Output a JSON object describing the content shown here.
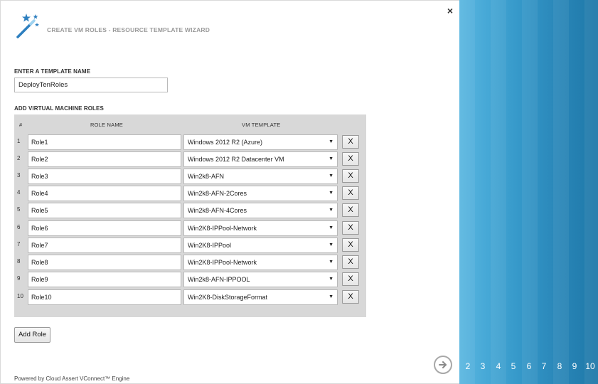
{
  "header": {
    "title": "CREATE VM ROLES - RESOURCE TEMPLATE WIZARD",
    "close_label": "×"
  },
  "template": {
    "label": "ENTER A TEMPLATE NAME",
    "value": "DeployTenRoles"
  },
  "roles": {
    "label": "ADD VIRTUAL MACHINE ROLES",
    "columns": {
      "hash": "#",
      "role_name": "ROLE NAME",
      "vm_template": "VM TEMPLATE"
    },
    "delete_label": "X",
    "rows": [
      {
        "num": "1",
        "name": "Role1",
        "template": "Windows 2012 R2 (Azure)"
      },
      {
        "num": "2",
        "name": "Role2",
        "template": "Windows 2012 R2 Datacenter VM"
      },
      {
        "num": "3",
        "name": "Role3",
        "template": "Win2k8-AFN"
      },
      {
        "num": "4",
        "name": "Role4",
        "template": "Win2k8-AFN-2Cores"
      },
      {
        "num": "5",
        "name": "Role5",
        "template": "Win2k8-AFN-4Cores"
      },
      {
        "num": "6",
        "name": "Role6",
        "template": "Win2K8-IPPool-Network"
      },
      {
        "num": "7",
        "name": "Role7",
        "template": "Win2K8-IPPool"
      },
      {
        "num": "8",
        "name": "Role8",
        "template": "Win2K8-IPPool-Network"
      },
      {
        "num": "9",
        "name": "Role9",
        "template": "Win2k8-AFN-IPPOOL"
      },
      {
        "num": "10",
        "name": "Role10",
        "template": "Win2K8-DiskStorageFormat"
      }
    ]
  },
  "add_role_label": "Add Role",
  "footer": "Powered by Cloud Assert VConnect™ Engine",
  "steps": [
    "2",
    "3",
    "4",
    "5",
    "6",
    "7",
    "8",
    "9",
    "10"
  ],
  "colors": {
    "accent": "#2a87b9",
    "panel": "#d8d8d8"
  }
}
